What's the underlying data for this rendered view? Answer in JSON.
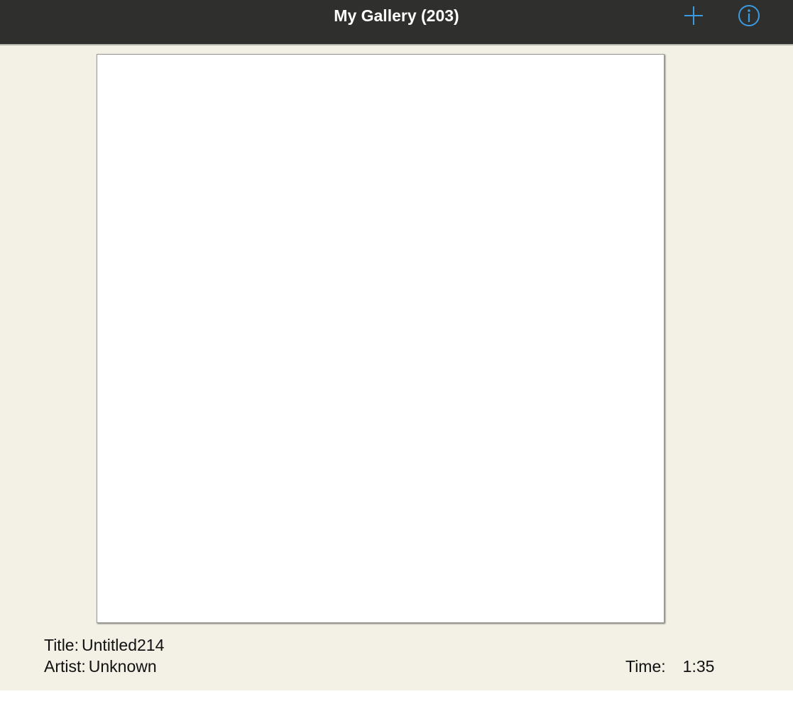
{
  "header": {
    "title": "My Gallery (203)",
    "add_icon": "plus-icon",
    "info_icon": "info-icon",
    "icon_color": "#3a9be0",
    "background": "#2f2f2d"
  },
  "artwork": {
    "title_label": "Title:",
    "title_value": "Untitled214",
    "artist_label": "Artist:",
    "artist_value": "Unknown",
    "time_label": "Time:",
    "time_value": "1:35"
  }
}
